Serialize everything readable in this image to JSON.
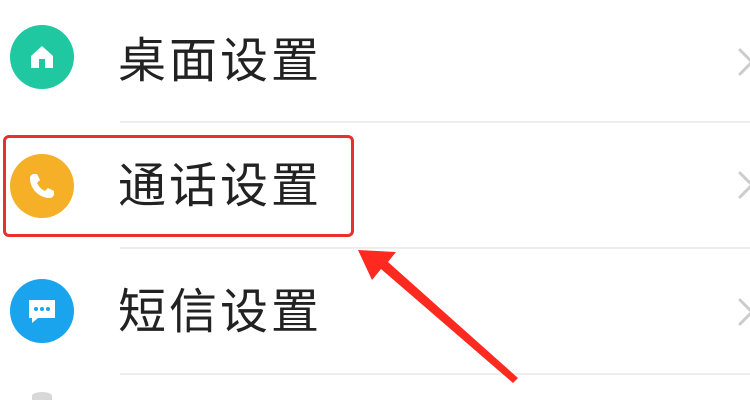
{
  "settings": {
    "items": [
      {
        "label": "桌面设置",
        "icon": "home-icon",
        "icon_bg": "#1fc8a0"
      },
      {
        "label": "通话设置",
        "icon": "phone-icon",
        "icon_bg": "#f5b027"
      },
      {
        "label": "短信设置",
        "icon": "message-icon",
        "icon_bg": "#1aa4ee"
      }
    ]
  },
  "colors": {
    "highlight": "#e8312a",
    "divider": "#eeeeee",
    "text": "#222222",
    "chevron": "#cccccc"
  }
}
